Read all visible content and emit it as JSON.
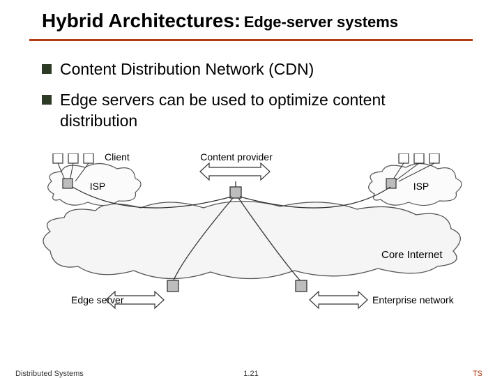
{
  "title_main": "Hybrid Architectures:",
  "title_sub": " Edge-server systems",
  "bullets": [
    "Content Distribution Network (CDN)",
    "Edge servers can be used to optimize content distribution"
  ],
  "diagram": {
    "labels": {
      "client": "Client",
      "content_provider": "Content provider",
      "isp_left": "ISP",
      "isp_right": "ISP",
      "core_internet": "Core Internet",
      "edge_server": "Edge server",
      "enterprise_network": "Enterprise network"
    }
  },
  "footer": {
    "left": "Distributed Systems",
    "center": "1.21",
    "right": "TS"
  }
}
